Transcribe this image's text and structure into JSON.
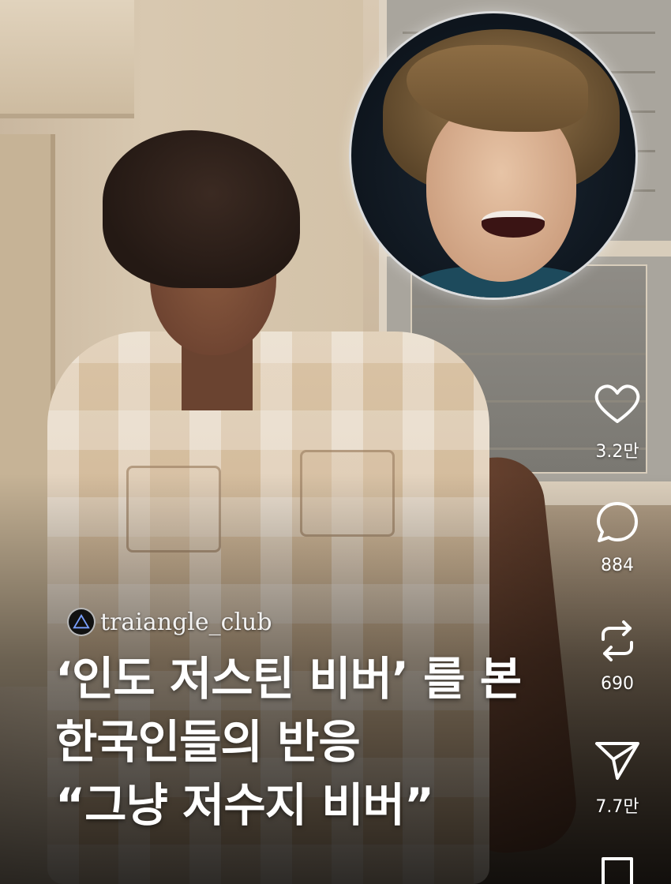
{
  "post": {
    "account": "traiangle_club",
    "headline": [
      "‘인도 저스틴 비버’ 를 본",
      "한국인들의 반응",
      "“그냥 저수지 비버”"
    ]
  },
  "actions": {
    "like": {
      "icon": "heart-icon",
      "count": "3.2만"
    },
    "comment": {
      "icon": "comment-icon",
      "count": "884"
    },
    "repost": {
      "icon": "repost-icon",
      "count": "690"
    },
    "share": {
      "icon": "send-icon",
      "count": "7.7만"
    },
    "save": {
      "icon": "bookmark-icon"
    }
  },
  "colors": {
    "overlay_text": "#ffffff",
    "background": "#000000"
  }
}
